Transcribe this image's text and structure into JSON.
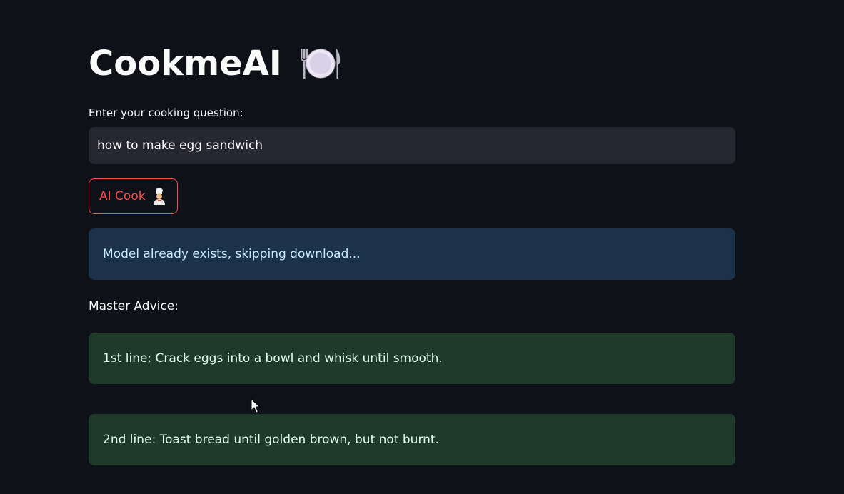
{
  "app": {
    "title": "CookmeAI",
    "title_icon": "plate-with-cutlery-icon"
  },
  "query": {
    "label": "Enter your cooking question:",
    "value": "how to make egg sandwich"
  },
  "cook_button": {
    "label": "AI Cook",
    "icon": "chef-icon",
    "color": "#ff4b4b"
  },
  "status": {
    "info_message": "Model already exists, skipping download..."
  },
  "advice": {
    "heading": "Master Advice:",
    "lines": [
      "1st line: Crack eggs into a bowl and whisk until smooth.",
      "2nd line: Toast bread until golden brown, but not burnt."
    ]
  },
  "colors": {
    "background": "#0e1117",
    "input_bg": "#262730",
    "info_bg": "#1c3249",
    "success_bg": "#1f3a2b",
    "accent": "#ff4b4b"
  }
}
